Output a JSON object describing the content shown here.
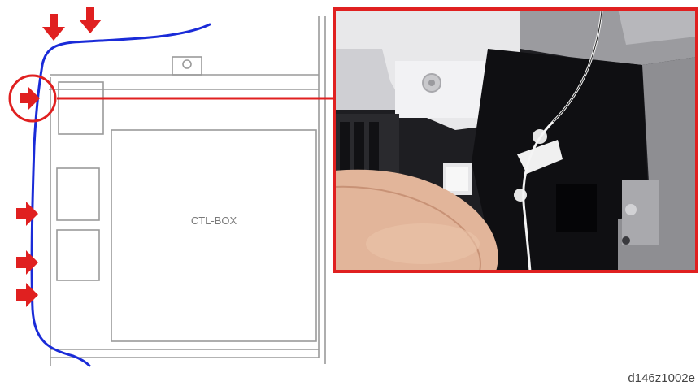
{
  "diagram": {
    "box_label": "CTL-BOX",
    "figure_id": "d146z1002e"
  },
  "colors": {
    "arrow": "#e02020",
    "harness": "#1a2bd8",
    "callout": "#e02020",
    "line_art": "#9a9a9a"
  }
}
